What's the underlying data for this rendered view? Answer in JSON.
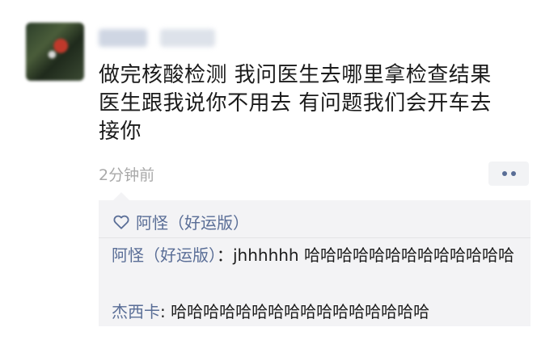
{
  "post": {
    "lines": [
      "做完核酸检测 我问医生去哪里拿检查结果",
      "医生跟我说你不用去 有问题我们会开车去",
      "接你"
    ],
    "timestamp": "2分钟前"
  },
  "likes": {
    "names": "阿怪（好运版）"
  },
  "comments": [
    {
      "author": "阿怪（好运版）",
      "separator": "：",
      "text": "jhhhhhh 哈哈哈哈哈哈哈哈哈哈哈哈哈"
    },
    {
      "author": "杰西卡",
      "separator": ": ",
      "text": "哈哈哈哈哈哈哈哈哈哈哈哈哈哈哈哈"
    }
  ],
  "icons": {
    "like": "heart-outline-icon",
    "more": "more-dots-icon"
  },
  "colors": {
    "link": "#596d96",
    "text": "#1b1b1b",
    "muted": "#a9a9a9",
    "comment_bg": "#f3f3f5"
  }
}
